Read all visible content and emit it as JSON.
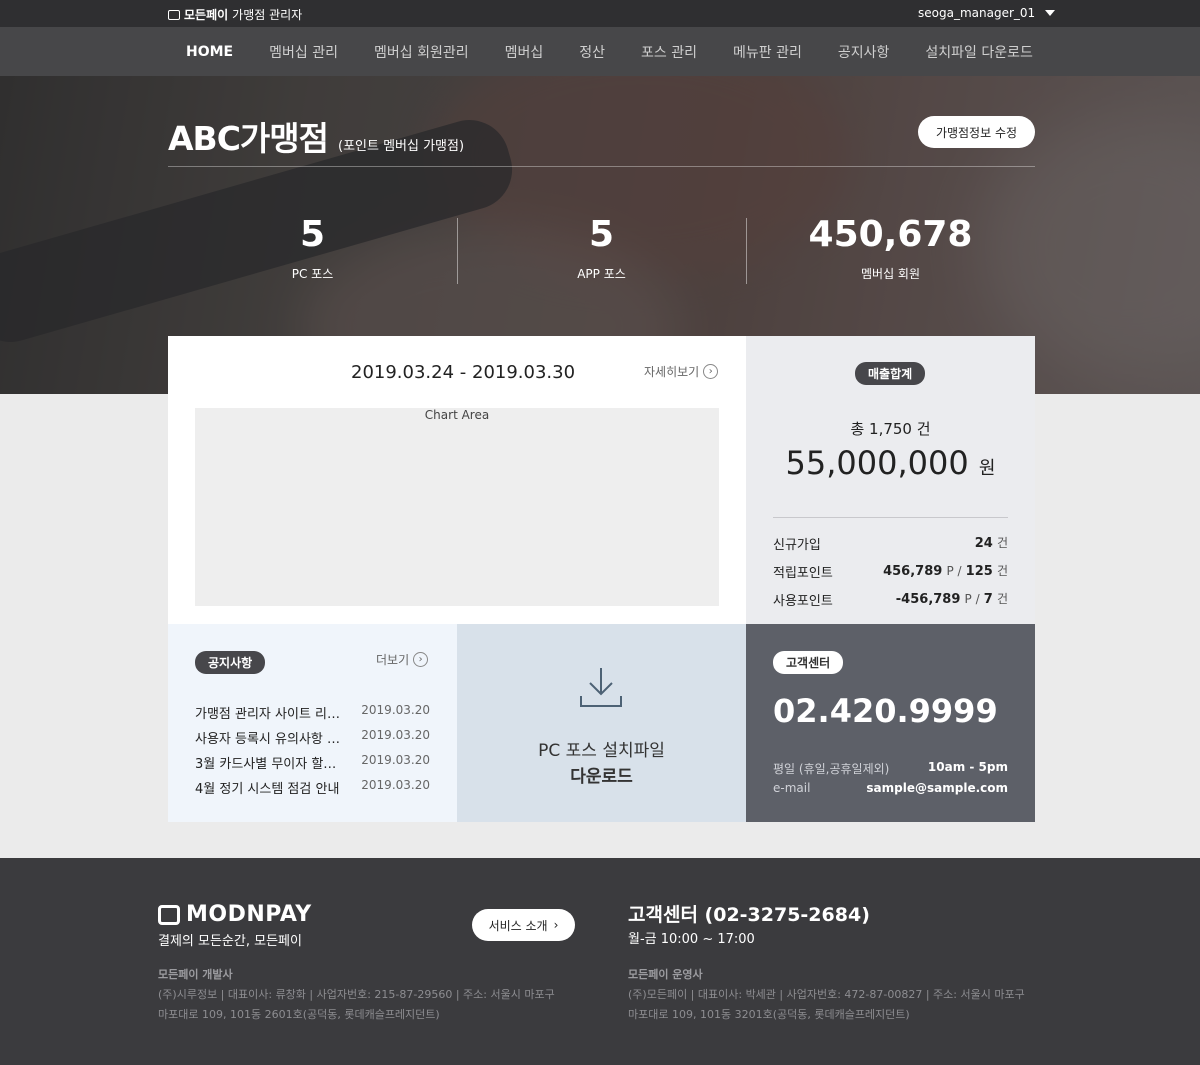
{
  "topbar": {
    "brand_bold": "모든페이",
    "brand_rest": "가맹점 관리자",
    "user": "seoga_manager_01"
  },
  "nav": {
    "items": [
      "HOME",
      "멤버십 관리",
      "멤버십 회원관리",
      "멤버십",
      "정산",
      "포스 관리",
      "메뉴판 관리",
      "공지사항",
      "설치파일 다운로드"
    ]
  },
  "store": {
    "name": "ABC가맹점",
    "type": "(포인트 멤버십 가맹점)",
    "edit_label": "가맹점정보 수정"
  },
  "stats": [
    {
      "value": "5",
      "label": "PC 포스"
    },
    {
      "value": "5",
      "label": "APP 포스"
    },
    {
      "value": "450,678",
      "label": "멤버십 회원"
    }
  ],
  "chart_card": {
    "range": "2019.03.24 - 2019.03.30",
    "more_label": "자세히보기",
    "placeholder": "Chart Area"
  },
  "sales": {
    "badge": "매출합계",
    "count": "총 1,750 건",
    "amount": "55,000,000",
    "amount_unit": "원",
    "rows": [
      {
        "label": "신규가입",
        "value": "24",
        "unit": "건"
      },
      {
        "label": "적립포인트",
        "value": "456,789",
        "mid": "P /",
        "value2": "125",
        "unit": "건"
      },
      {
        "label": "사용포인트",
        "value": "-456,789",
        "mid": "P /",
        "value2": "7",
        "unit": "건"
      }
    ]
  },
  "notice": {
    "badge": "공지사항",
    "more_label": "더보기",
    "items": [
      {
        "title": "가맹점 관리자 사이트 리…",
        "date": "2019.03.20"
      },
      {
        "title": "사용자 등록시 유의사항 …",
        "date": "2019.03.20"
      },
      {
        "title": "3월 카드사별 무이자 할…",
        "date": "2019.03.20"
      },
      {
        "title": "4월 정기 시스템 점검 안내",
        "date": "2019.03.20"
      }
    ]
  },
  "download": {
    "line1": "PC 포스 설치파일",
    "line2": "다운로드",
    "icon": "download-icon"
  },
  "customer_center": {
    "badge": "고객센터",
    "phone": "02.420.9999",
    "rows": [
      {
        "label": "평일 (휴일,공휴일제외)",
        "value": "10am - 5pm"
      },
      {
        "label": "e-mail",
        "value": "sample@sample.com"
      }
    ]
  },
  "footer": {
    "logo": "MODNPAY",
    "slogan": "결제의 모든순간, 모든페이",
    "service_label": "서비스 소개",
    "cs_title": "고객센터 (02-3275-2684)",
    "cs_hours": "월-금 10:00 ~ 17:00",
    "dev": {
      "title": "모든페이 개발사",
      "line1": "(주)시루정보 | 대표이사: 류창화 | 사업자번호: 215-87-29560 | 주소: 서울시 마포구",
      "line2": "마포대로 109, 101동 2601호(공덕동, 롯데캐슬프레지던트)"
    },
    "op": {
      "title": "모든페이 운영사",
      "line1": "(주)모든페이 | 대표이사: 박세관 | 사업자번호: 472-87-00827 | 주소: 서울시 마포구",
      "line2": "마포대로 109, 101동 3201호(공덕동, 롯데캐슬프레지던트)"
    }
  },
  "colors": {
    "topbar": "#2f2f31",
    "nav": "#474749",
    "footer": "#3b3b3e",
    "cs_card": "#5d6068",
    "download_card": "#d8e1ea",
    "notice_card": "#f0f5fb"
  }
}
